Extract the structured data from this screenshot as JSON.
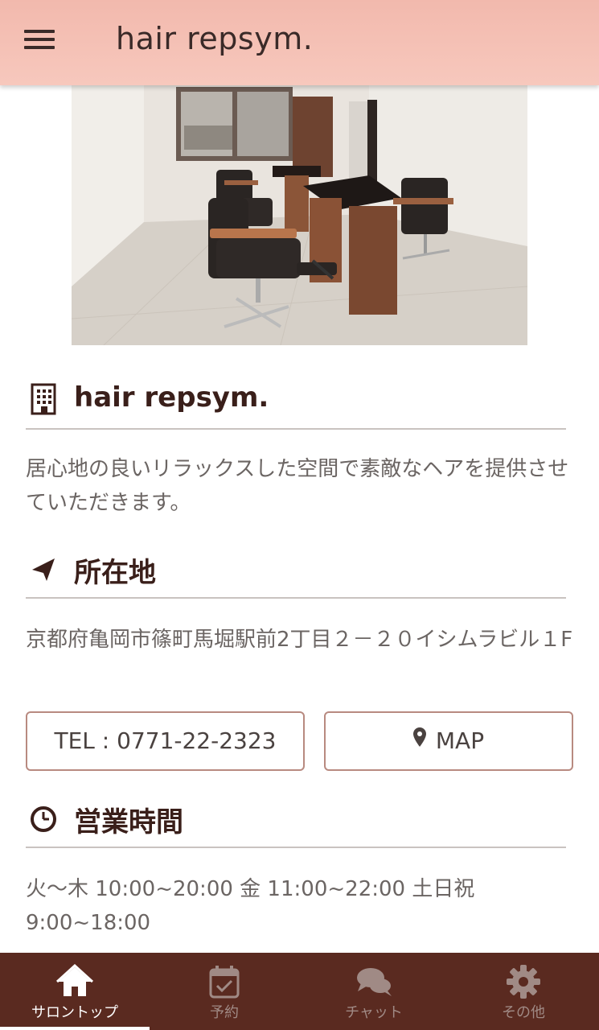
{
  "header": {
    "title": "hair repsym."
  },
  "salon": {
    "name": "hair repsym.",
    "description": "居心地の良いリラックスした空間で素敵なヘアを提供させていただきます。"
  },
  "location": {
    "title": "所在地",
    "address": "京都府亀岡市篠町馬堀駅前2丁目２－２０イシムラビル１F",
    "tel_label": "TEL : 0771-22-2323",
    "map_label": "MAP"
  },
  "hours": {
    "title": "営業時間",
    "text": "火〜木 10:00~20:00 金 11:00~22:00 土日祝 9:00~18:00"
  },
  "tabs": [
    {
      "label": "サロントップ",
      "icon": "home-icon"
    },
    {
      "label": "予約",
      "icon": "calendar-check-icon"
    },
    {
      "label": "チャット",
      "icon": "chat-bubbles-icon"
    },
    {
      "label": "その他",
      "icon": "gear-icon"
    }
  ],
  "colors": {
    "header": "#f5c0b4",
    "tabbar": "#5a2a20",
    "accent": "#3a1f1a",
    "button_border": "#b88a80"
  }
}
